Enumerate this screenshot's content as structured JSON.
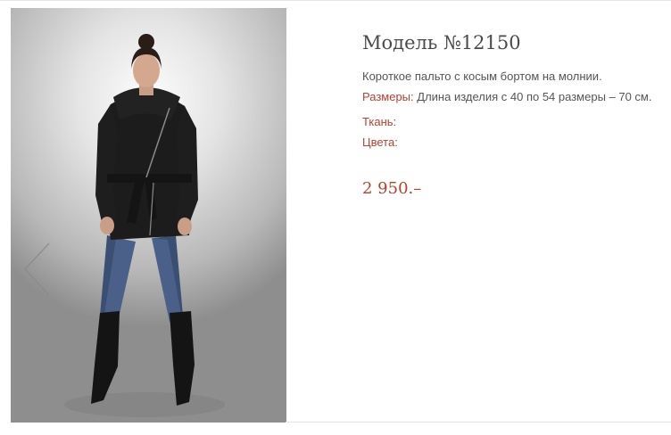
{
  "product": {
    "title": "Модель №12150",
    "description": "Короткое пальто с косым бортом на молнии.",
    "sizes_label": "Размеры:",
    "sizes_value": "Длина изделия с 40 по 54 размеры – 70 см.",
    "fabric_label": "Ткань:",
    "fabric_value": "",
    "colors_label": "Цвета:",
    "colors_value": "",
    "price": "2 950.–"
  },
  "gallery": {
    "prev_icon": "chevron-left-icon"
  },
  "colors": {
    "accent": "#b5412f",
    "text": "#555555",
    "title": "#4a4a4a"
  }
}
